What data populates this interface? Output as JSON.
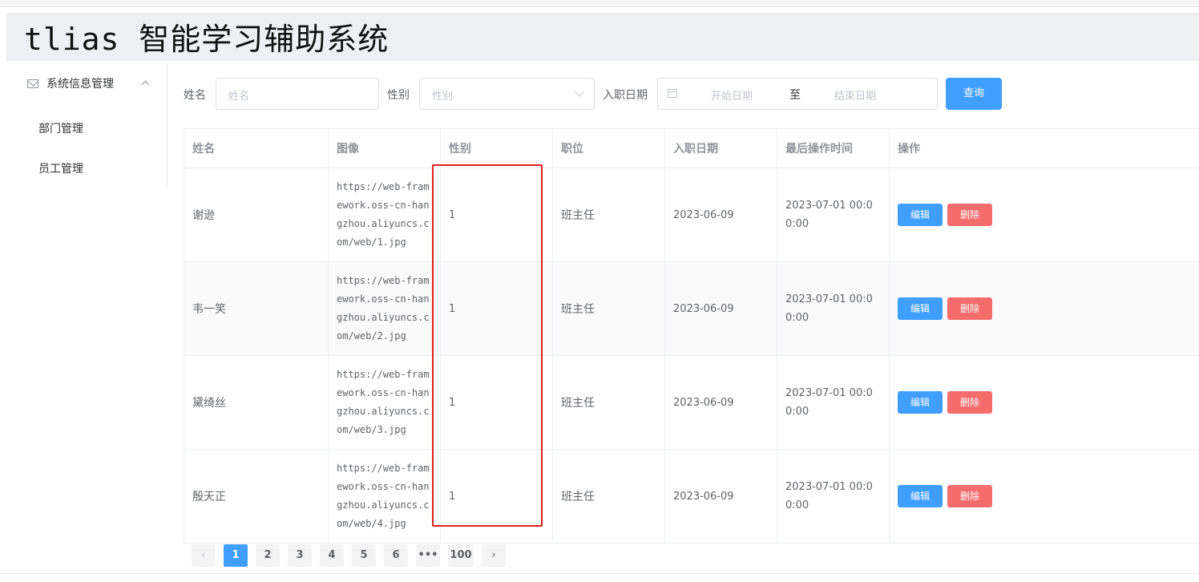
{
  "app": {
    "title": "tlias 智能学习辅助系统"
  },
  "sidebar": {
    "group_label": "系统信息管理",
    "items": [
      {
        "label": "部门管理"
      },
      {
        "label": "员工管理"
      }
    ]
  },
  "filters": {
    "name_label": "姓名",
    "name_placeholder": "姓名",
    "gender_label": "性别",
    "gender_placeholder": "性别",
    "date_label": "入职日期",
    "start_placeholder": "开始日期",
    "range_separator": "至",
    "end_placeholder": "结束日期",
    "query_label": "查询"
  },
  "table": {
    "columns": [
      "姓名",
      "图像",
      "性别",
      "职位",
      "入职日期",
      "最后操作时间",
      "操作"
    ],
    "rows": [
      {
        "name": "谢逊",
        "image": "https://web-framework.oss-cn-hangzhou.aliyuncs.com/web/1.jpg",
        "gender": "1",
        "job": "班主任",
        "entrydate": "2023-06-09",
        "update_time": "2023-07-01 00:00:00"
      },
      {
        "name": "韦一笑",
        "image": "https://web-framework.oss-cn-hangzhou.aliyuncs.com/web/2.jpg",
        "gender": "1",
        "job": "班主任",
        "entrydate": "2023-06-09",
        "update_time": "2023-07-01 00:00:00"
      },
      {
        "name": "黛绮丝",
        "image": "https://web-framework.oss-cn-hangzhou.aliyuncs.com/web/3.jpg",
        "gender": "1",
        "job": "班主任",
        "entrydate": "2023-06-09",
        "update_time": "2023-07-01 00:00:00"
      },
      {
        "name": "殷天正",
        "image": "https://web-framework.oss-cn-hangzhou.aliyuncs.com/web/4.jpg",
        "gender": "1",
        "job": "班主任",
        "entrydate": "2023-06-09",
        "update_time": "2023-07-01 00:00:00"
      }
    ],
    "edit_label": "编辑",
    "delete_label": "删除"
  },
  "pagination": {
    "pages": [
      "1",
      "2",
      "3",
      "4",
      "5",
      "6",
      "•••",
      "100"
    ],
    "current": "1",
    "prev_icon": "chevron-left-icon",
    "next_icon": "chevron-right-icon"
  },
  "colors": {
    "primary": "#409eff",
    "danger": "#f56c6c",
    "highlight": "#e02020"
  }
}
